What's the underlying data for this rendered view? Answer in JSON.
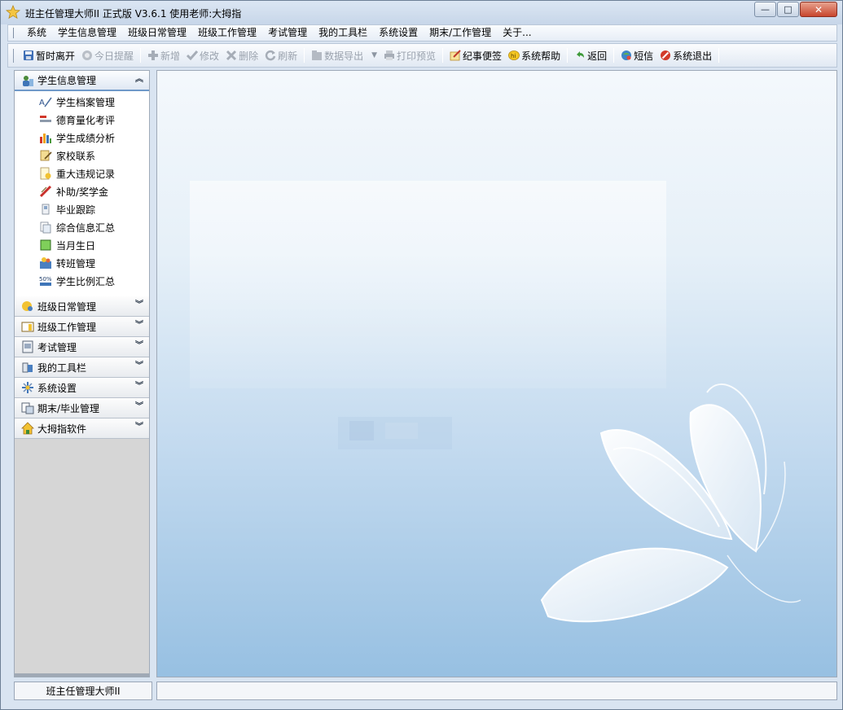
{
  "window": {
    "title": "班主任管理大师II 正式版 V3.6.1  使用老师:大拇指",
    "controls": {
      "minimize": "—",
      "maximize": "□",
      "close": "✕"
    }
  },
  "menu": {
    "items": [
      "系统",
      "学生信息管理",
      "班级日常管理",
      "班级工作管理",
      "考试管理",
      "我的工具栏",
      "系统设置",
      "期末/工作管理",
      "关于..."
    ]
  },
  "toolbar": {
    "buttons": [
      {
        "label": "暂时离开",
        "icon": "save-icon",
        "enabled": true
      },
      {
        "label": "今日提醒",
        "icon": "reminder-icon",
        "enabled": false
      },
      {
        "label": "新增",
        "icon": "plus-icon",
        "enabled": false
      },
      {
        "label": "修改",
        "icon": "check-icon",
        "enabled": false
      },
      {
        "label": "删除",
        "icon": "delete-icon",
        "enabled": false
      },
      {
        "label": "刷新",
        "icon": "refresh-icon",
        "enabled": false
      },
      {
        "label": "数据导出",
        "icon": "export-icon",
        "enabled": false
      },
      {
        "label": "打印预览",
        "icon": "print-icon",
        "enabled": false
      },
      {
        "label": "纪事便签",
        "icon": "note-icon",
        "enabled": true
      },
      {
        "label": "系统帮助",
        "icon": "help-icon",
        "enabled": true
      },
      {
        "label": "返回",
        "icon": "back-icon",
        "enabled": true
      },
      {
        "label": "短信",
        "icon": "sms-icon",
        "enabled": true
      },
      {
        "label": "系统退出",
        "icon": "exit-icon",
        "enabled": true
      }
    ]
  },
  "sidebar": {
    "active_group": {
      "label": "学生信息管理",
      "chevron": "︽",
      "items": [
        {
          "label": "学生档案管理",
          "icon": "archive-icon"
        },
        {
          "label": "德育量化考评",
          "icon": "evaluation-icon"
        },
        {
          "label": "学生成绩分析",
          "icon": "bar-chart-icon"
        },
        {
          "label": "家校联系",
          "icon": "contact-icon"
        },
        {
          "label": "重大违规记录",
          "icon": "record-icon"
        },
        {
          "label": "补助/奖学金",
          "icon": "scholarship-icon"
        },
        {
          "label": "毕业跟踪",
          "icon": "tracking-icon"
        },
        {
          "label": "综合信息汇总",
          "icon": "summary-icon"
        },
        {
          "label": "当月生日",
          "icon": "birthday-icon"
        },
        {
          "label": "转班管理",
          "icon": "transfer-icon"
        },
        {
          "label": "学生比例汇总",
          "icon": "percent-icon"
        }
      ]
    },
    "groups": [
      {
        "label": "班级日常管理",
        "chevron": "︾"
      },
      {
        "label": "班级工作管理",
        "chevron": "︾"
      },
      {
        "label": "考试管理",
        "chevron": "︾"
      },
      {
        "label": "我的工具栏",
        "chevron": "︾"
      },
      {
        "label": "系统设置",
        "chevron": "︾"
      },
      {
        "label": "期末/毕业管理",
        "chevron": "︾"
      },
      {
        "label": "大拇指软件",
        "chevron": "︾"
      }
    ]
  },
  "statusbar": {
    "app_name": "班主任管理大师II",
    "message": ""
  },
  "colors": {
    "accent": "#6f99c9",
    "disabled_text": "#9aa2ad",
    "main_gradient_bottom": "#97c0e2"
  }
}
